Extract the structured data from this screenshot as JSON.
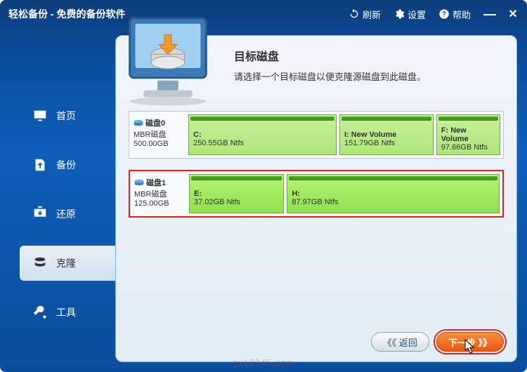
{
  "title": "轻松备份 - 免费的备份软件",
  "titlebar": {
    "refresh": "刷新",
    "settings": "设置",
    "help": "帮助"
  },
  "sidebar": {
    "items": [
      {
        "label": "首页"
      },
      {
        "label": "备份"
      },
      {
        "label": "还原"
      },
      {
        "label": "克隆"
      },
      {
        "label": "工具"
      }
    ],
    "active_index": 3
  },
  "main": {
    "heading": "目标磁盘",
    "subheading": "请选择一个目标磁盘以便克隆源磁盘到此磁盘。"
  },
  "disks": [
    {
      "name": "磁盘0",
      "type": "MBR磁盘",
      "size": "500.00GB",
      "selected": false,
      "partitions": [
        {
          "label": "C:",
          "detail": "250.55GB Ntfs",
          "flex": 250
        },
        {
          "label": "I: New Volume",
          "detail": "151.79GB Ntfs",
          "flex": 152
        },
        {
          "label": "F: New Volume",
          "detail": "97.66GB Ntfs",
          "flex": 98
        }
      ]
    },
    {
      "name": "磁盘1",
      "type": "MBR磁盘",
      "size": "125.00GB",
      "selected": true,
      "partitions": [
        {
          "label": "E:",
          "detail": "37.02GB Ntfs",
          "flex": 37
        },
        {
          "label": "H:",
          "detail": "87.97GB Ntfs",
          "flex": 88
        }
      ]
    }
  ],
  "footer": {
    "back": "《《 返回",
    "next": "下一步 》》"
  },
  "watermark": "gx12345.com"
}
